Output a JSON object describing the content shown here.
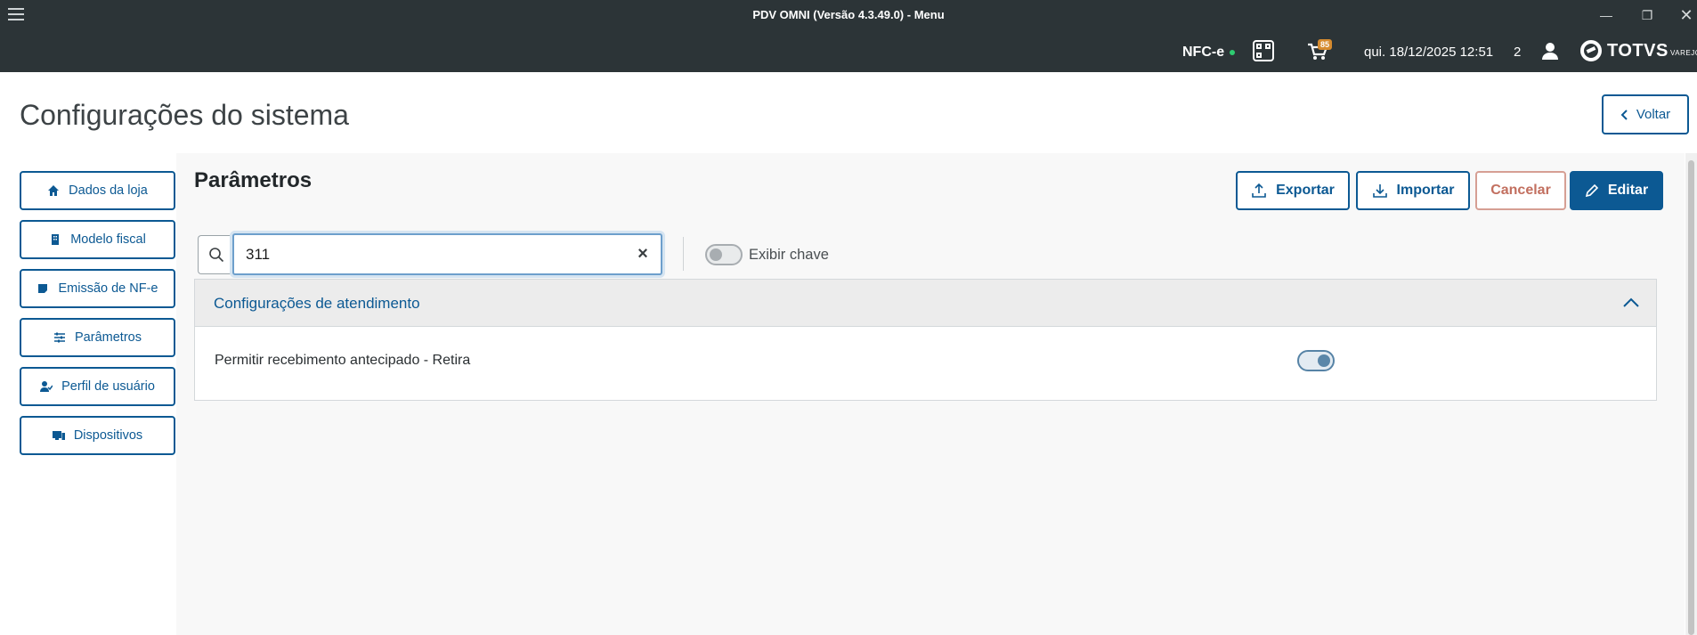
{
  "window": {
    "title": "PDV OMNI (Versão 4.3.49.0) - Menu",
    "controls": {
      "minimize": "—",
      "maximize": "❐",
      "close": "✕"
    }
  },
  "header": {
    "nfce_label": "NFC-e",
    "cart_badge": "85",
    "datetime": "qui. 18/12/2025 12:51",
    "user_count": "2",
    "brand": "TOTVS",
    "brand_sub": "VAREJO"
  },
  "page": {
    "title": "Configurações do sistema",
    "back_label": "Voltar"
  },
  "sidebar": {
    "items": [
      {
        "label": "Dados da loja",
        "icon": "home-icon"
      },
      {
        "label": "Modelo fiscal",
        "icon": "building-icon"
      },
      {
        "label": "Emissão de NF-e",
        "icon": "document-icon"
      },
      {
        "label": "Parâmetros",
        "icon": "sliders-icon"
      },
      {
        "label": "Perfil de usuário",
        "icon": "user-check-icon"
      },
      {
        "label": "Dispositivos",
        "icon": "devices-icon"
      }
    ]
  },
  "main": {
    "section_title": "Parâmetros",
    "actions": {
      "export_label": "Exportar",
      "import_label": "Importar",
      "cancel_label": "Cancelar",
      "edit_label": "Editar"
    },
    "search": {
      "value": "311",
      "placeholder": ""
    },
    "show_key_label": "Exibir chave",
    "show_key_enabled": false,
    "accordion": {
      "title": "Configurações de atendimento",
      "rows": [
        {
          "label": "Permitir recebimento antecipado - Retira",
          "enabled": true
        }
      ]
    }
  },
  "colors": {
    "primary": "#0c5993",
    "header_bg": "#2c3437",
    "cancel": "#c26f5f",
    "badge": "#d68b2f"
  }
}
